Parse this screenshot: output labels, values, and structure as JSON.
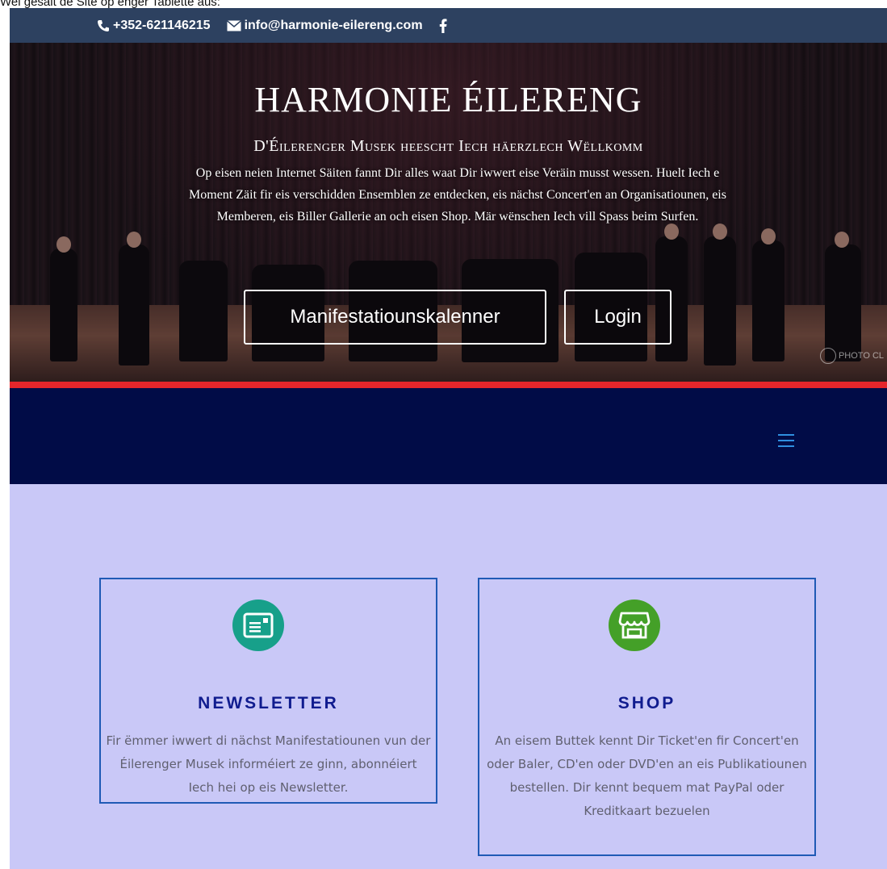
{
  "caption": "Wei gesäit de Site op enger Tablette aus:",
  "topbar": {
    "phone": "+352-621146215",
    "email": "info@harmonie-eilereng.com",
    "facebook_icon": "facebook-icon"
  },
  "hero": {
    "title": "HARMONIE ÉILERENG",
    "subtitle": "D'Éilerenger Musek heescht Iech häerzlech Wëllkomm",
    "intro": "Op eisen neien Internet Säiten fannt Dir alles waat Dir iwwert eise Veräin musst wessen. Huelt Iech e Moment Zäit fir eis verschidden Ensemblen ze entdecken, eis nächst Concert'en an Organisatiounen, eis Memberen, eis Biller Gallerie an och eisen Shop. Mär wënschen Iech vill Spass beim Surfen.",
    "btn_calendar": "Manifestatiounskalenner",
    "btn_login": "Login",
    "watermark": "PHOTO CL"
  },
  "colors": {
    "topbar": "#2d4160",
    "redline": "#e5262b",
    "navbar": "#010c47",
    "content_bg": "#c9c8f7",
    "card_border": "#1f5ab5",
    "card_title": "#101c8f",
    "newsletter_icon_bg": "#17a08a",
    "shop_icon_bg": "#44a028"
  },
  "nav": {
    "menu_icon": "hamburger-menu-icon"
  },
  "cards": {
    "newsletter": {
      "icon": "newsletter-postcard-icon",
      "title": "NEWSLETTER",
      "text": "Fir ëmmer iwwert di nächst Manifestatiounen vun der Éilerenger Musek informéiert ze ginn, abonnéiert Iech hei op eis Newsletter."
    },
    "shop": {
      "icon": "shop-storefront-icon",
      "title": "SHOP",
      "text": "An eisem Buttek kennt Dir Ticket'en fir Concert'en oder Baler, CD'en oder DVD'en an eis Publikatiounen bestellen. Dir kennt bequem mat PayPal oder Kreditkaart bezuelen"
    }
  }
}
